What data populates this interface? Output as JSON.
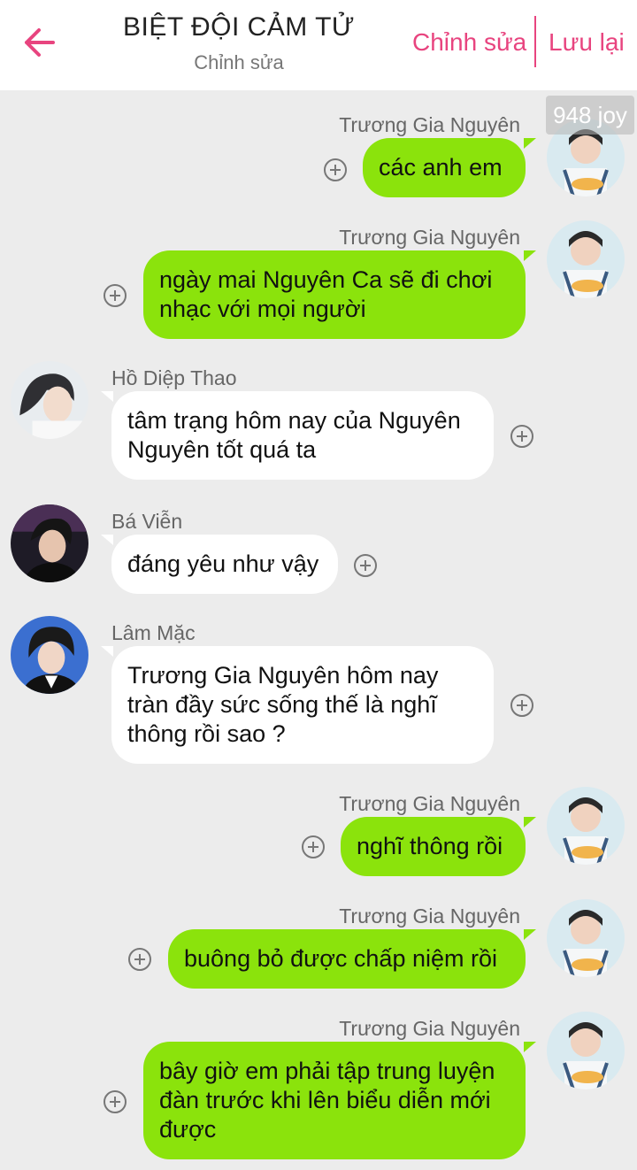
{
  "header": {
    "title": "BIỆT ĐỘI CẢM TỬ",
    "subtitle": "Chỉnh sửa",
    "edit_label": "Chỉnh sửa",
    "save_label": "Lưu lại"
  },
  "watermark": "948 joy",
  "messages": [
    {
      "sender": "Trương Gia Nguyên",
      "side": "right",
      "text": "các anh em"
    },
    {
      "sender": "Trương Gia Nguyên",
      "side": "right",
      "text": "ngày mai Nguyên Ca sẽ đi chơi nhạc với mọi người"
    },
    {
      "sender": "Hồ Diệp Thao",
      "side": "left",
      "text": "tâm trạng hôm nay của Nguyên Nguyên tốt quá ta"
    },
    {
      "sender": "Bá Viễn",
      "side": "left",
      "text": "đáng yêu như vậy"
    },
    {
      "sender": "Lâm Mặc",
      "side": "left",
      "text": "Trương Gia Nguyên hôm nay tràn đầy sức sống thế là nghĩ thông rồi sao ?"
    },
    {
      "sender": "Trương Gia Nguyên",
      "side": "right",
      "text": "nghĩ thông rồi"
    },
    {
      "sender": "Trương Gia Nguyên",
      "side": "right",
      "text": "buông bỏ được chấp niệm rồi"
    },
    {
      "sender": "Trương Gia Nguyên",
      "side": "right",
      "text": "bây giờ em phải tập trung luyện đàn trước khi lên biểu diễn mới được"
    }
  ],
  "colors": {
    "accent": "#e8447f",
    "own_bubble": "#8be30c",
    "other_bubble": "#ffffff",
    "background": "#ececec"
  }
}
